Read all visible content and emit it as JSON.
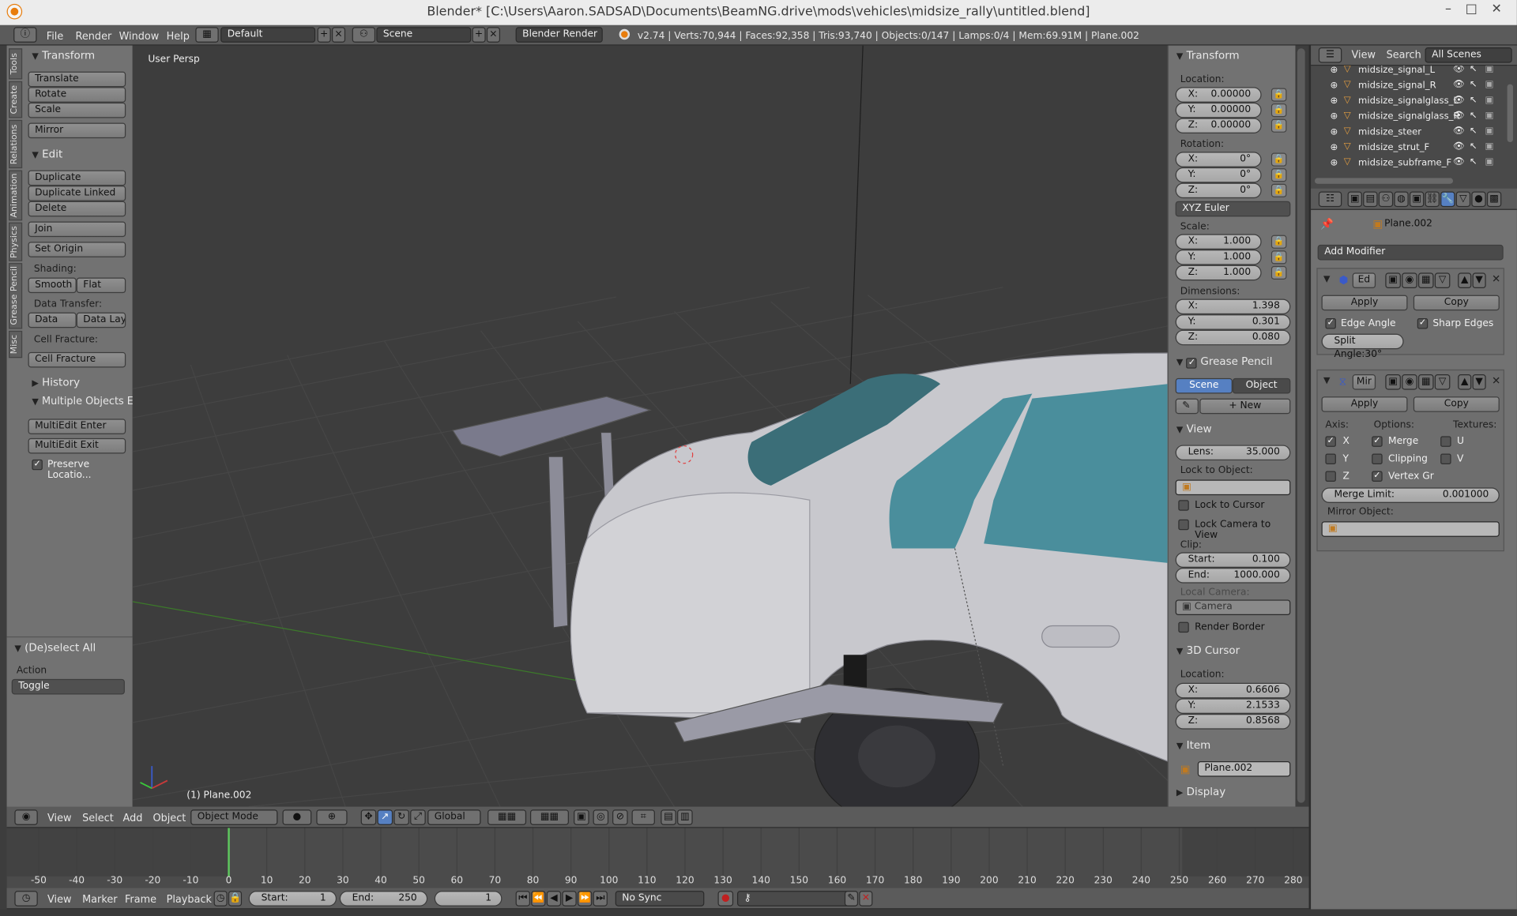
{
  "title": "Blender* [C:\\Users\\Aaron.SADSAD\\Documents\\BeamNG.drive\\mods\\vehicles\\midsize_rally\\untitled.blend]",
  "window_controls": {
    "min": "–",
    "max": "□",
    "close": "✕"
  },
  "info_header": {
    "menus": [
      "File",
      "Render",
      "Window",
      "Help"
    ],
    "layout": "Default",
    "scene": "Scene",
    "engine": "Blender Render",
    "stats": "v2.74 | Verts:70,944 | Faces:92,358 | Tris:93,740 | Objects:0/147 | Lamps:0/4 | Mem:69.91M | Plane.002"
  },
  "tool_tabs": [
    "Tools",
    "Create",
    "Relations",
    "Animation",
    "Physics",
    "Grease Pencil",
    "Misc"
  ],
  "tools": {
    "transform_title": "Transform",
    "translate": "Translate",
    "rotate": "Rotate",
    "scale": "Scale",
    "mirror": "Mirror",
    "edit_title": "Edit",
    "duplicate": "Duplicate",
    "duplicate_linked": "Duplicate Linked",
    "delete": "Delete",
    "join": "Join",
    "set_origin": "Set Origin",
    "shading_label": "Shading:",
    "smooth": "Smooth",
    "flat": "Flat",
    "data_transfer_label": "Data Transfer:",
    "data": "Data",
    "data_layo": "Data Layo",
    "cell_fracture_label": "Cell Fracture:",
    "cell_fracture": "Cell Fracture",
    "history_title": "History",
    "multiple_title": "Multiple Objects Edit",
    "multiedit_enter": "MultiEdit Enter",
    "multiedit_exit": "MultiEdit Exit",
    "preserve": "Preserve Locatio...",
    "deselect_title": "(De)select All",
    "action_label": "Action",
    "action_value": "Toggle"
  },
  "viewport": {
    "label": "User Persp",
    "object_label": "(1) Plane.002"
  },
  "properties_panel": {
    "transform_title": "Transform",
    "location_label": "Location:",
    "location": [
      {
        "k": "X:",
        "v": "0.00000"
      },
      {
        "k": "Y:",
        "v": "0.00000"
      },
      {
        "k": "Z:",
        "v": "0.00000"
      }
    ],
    "rotation_label": "Rotation:",
    "rotation": [
      {
        "k": "X:",
        "v": "0°"
      },
      {
        "k": "Y:",
        "v": "0°"
      },
      {
        "k": "Z:",
        "v": "0°"
      }
    ],
    "rotation_mode": "XYZ Euler",
    "scale_label": "Scale:",
    "scale": [
      {
        "k": "X:",
        "v": "1.000"
      },
      {
        "k": "Y:",
        "v": "1.000"
      },
      {
        "k": "Z:",
        "v": "1.000"
      }
    ],
    "dimensions_label": "Dimensions:",
    "dimensions": [
      {
        "k": "X:",
        "v": "1.398"
      },
      {
        "k": "Y:",
        "v": "0.301"
      },
      {
        "k": "Z:",
        "v": "0.080"
      }
    ],
    "grease_title": "Grease Pencil",
    "gp_scene": "Scene",
    "gp_object": "Object",
    "gp_new": "New",
    "view_title": "View",
    "lens_k": "Lens:",
    "lens_v": "35.000",
    "lock_to_object": "Lock to Object:",
    "lock_to_cursor": "Lock to Cursor",
    "lock_camera": "Lock Camera to View",
    "clip_label": "Clip:",
    "clip_start_k": "Start:",
    "clip_start_v": "0.100",
    "clip_end_k": "End:",
    "clip_end_v": "1000.000",
    "local_camera": "Local Camera:",
    "camera": "Camera",
    "render_border": "Render Border",
    "cursor_title": "3D Cursor",
    "cursor_location_label": "Location:",
    "cursor": [
      {
        "k": "X:",
        "v": "0.6606"
      },
      {
        "k": "Y:",
        "v": "2.1533"
      },
      {
        "k": "Z:",
        "v": "0.8568"
      }
    ],
    "item_title": "Item",
    "item_name": "Plane.002",
    "display_title": "Display"
  },
  "outliner": {
    "menus": [
      "View",
      "Search"
    ],
    "filter": "All Scenes",
    "items": [
      "midsize_signal_L",
      "midsize_signal_R",
      "midsize_signalglass_L",
      "midsize_signalglass_R",
      "midsize_steer",
      "midsize_strut_F",
      "midsize_subframe_F"
    ]
  },
  "modifiers": {
    "object": "Plane.002",
    "add_modifier": "Add Modifier",
    "edge_split": {
      "name": "Ed",
      "apply": "Apply",
      "copy": "Copy",
      "edge_angle": "Edge Angle",
      "sharp_edges": "Sharp Edges",
      "split_angle": "Split Angle:30°"
    },
    "mirror": {
      "name": "Mir",
      "apply": "Apply",
      "copy": "Copy",
      "axis": "Axis:",
      "options": "Options:",
      "textures": "Textures:",
      "x": "X",
      "y": "Y",
      "z": "Z",
      "merge": "Merge",
      "clipping": "Clipping",
      "vertex_gr": "Vertex Gr",
      "u": "U",
      "v": "V",
      "merge_limit_k": "Merge Limit:",
      "merge_limit_v": "0.001000",
      "mirror_object": "Mirror Object:"
    }
  },
  "view3d_header": {
    "menus": [
      "View",
      "Select",
      "Add",
      "Object"
    ],
    "mode": "Object Mode",
    "orientation": "Global"
  },
  "timeline": {
    "ticks": [
      "-50",
      "-40",
      "-30",
      "-20",
      "-10",
      "0",
      "10",
      "20",
      "30",
      "40",
      "50",
      "60",
      "70",
      "80",
      "90",
      "100",
      "110",
      "120",
      "130",
      "140",
      "150",
      "160",
      "170",
      "180",
      "190",
      "200",
      "210",
      "220",
      "230",
      "240",
      "250",
      "260",
      "270",
      "280"
    ],
    "current_frame": 0
  },
  "timeline_header": {
    "menus": [
      "View",
      "Marker",
      "Frame",
      "Playback"
    ],
    "start_k": "Start:",
    "start_v": "1",
    "end_k": "End:",
    "end_v": "250",
    "frame": "1",
    "sync": "No Sync"
  },
  "colors": {
    "accent_blue": "#5680c2",
    "header": "#5b5b5b",
    "panel": "#707070",
    "viewport": "#3d3d3d"
  }
}
